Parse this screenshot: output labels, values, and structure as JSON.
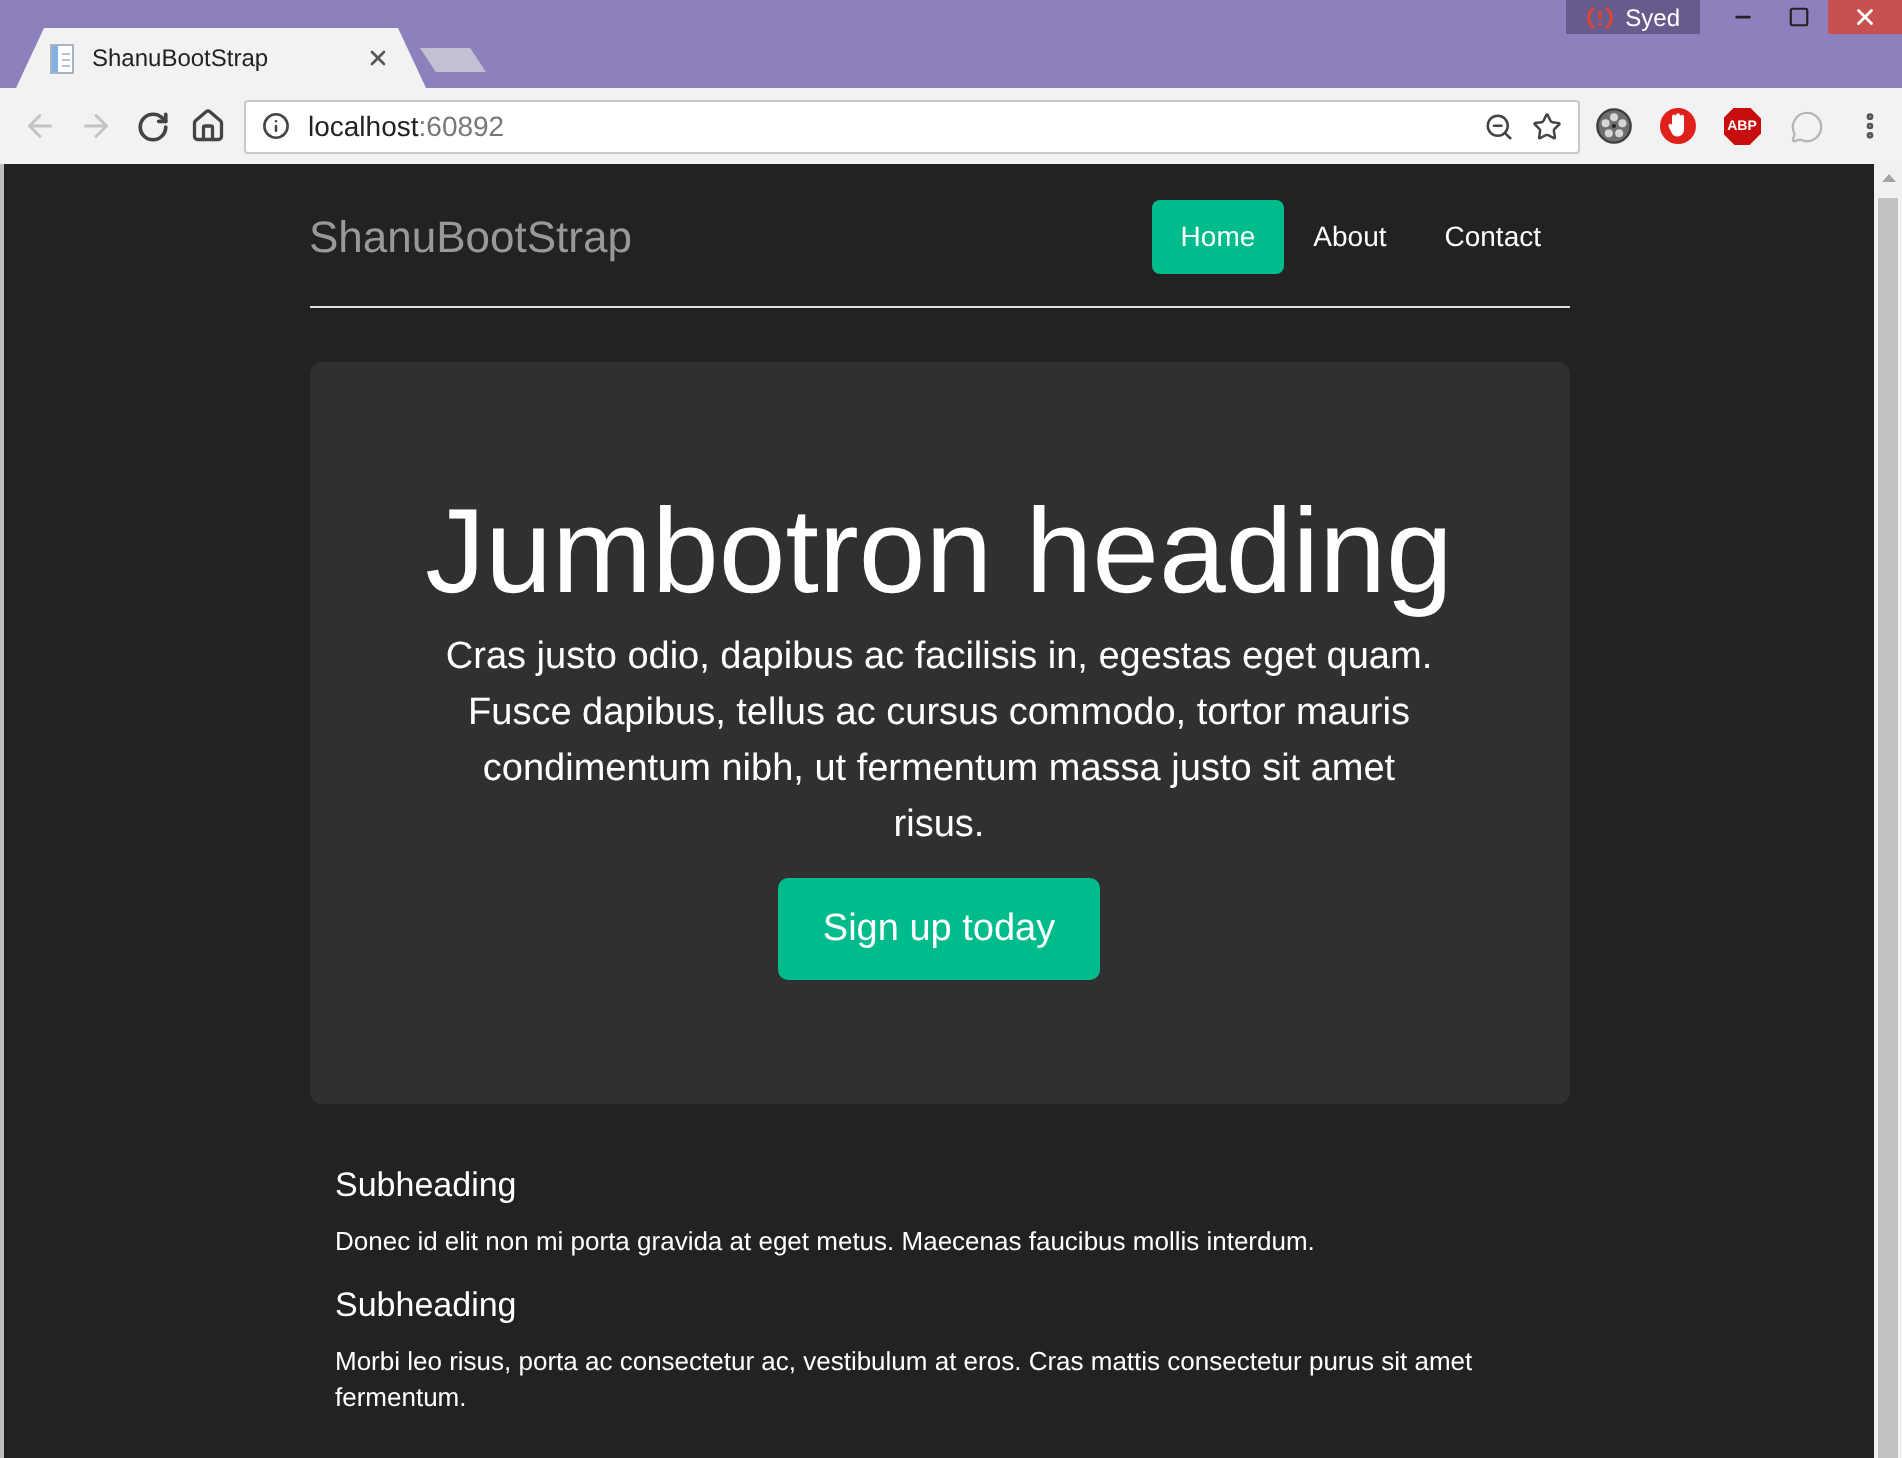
{
  "browser": {
    "tabs": [
      {
        "title": "ShanuBootStrap",
        "selected": true
      }
    ],
    "profile": {
      "name": "Syed"
    },
    "navigation": {
      "back_disabled": true,
      "forward_disabled": true
    },
    "address_bar": {
      "host": "localhost",
      "port": ":60892"
    },
    "extension_badge": "ABP"
  },
  "page": {
    "brand": "ShanuBootStrap",
    "nav": [
      {
        "label": "Home",
        "selected": true
      },
      {
        "label": "About",
        "selected": false
      },
      {
        "label": "Contact",
        "selected": false
      }
    ],
    "jumbotron": {
      "heading": "Jumbotron heading",
      "lead": "Cras justo odio, dapibus ac facilisis in, egestas eget quam. Fusce dapibus, tellus ac cursus commodo, tortor mauris condimentum nibh, ut fermentum massa justo sit amet risus.",
      "button": "Sign up today"
    },
    "sections": [
      {
        "heading": "Subheading",
        "text": "Donec id elit non mi porta gravida at eget metus. Maecenas faucibus mollis interdum."
      },
      {
        "heading": "Subheading",
        "text": "Morbi leo risus, porta ac consectetur ac, vestibulum at eros. Cras mattis consectetur purus sit amet fermentum."
      }
    ]
  }
}
